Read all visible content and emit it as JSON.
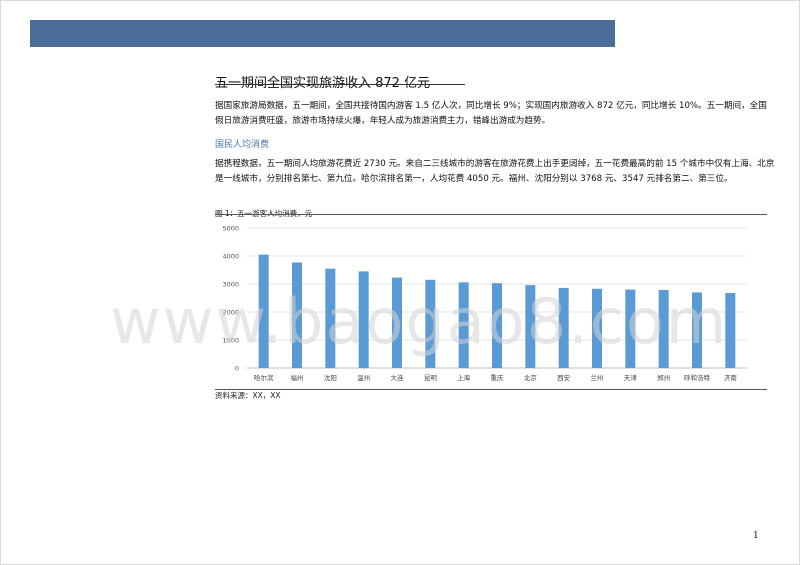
{
  "colors": {
    "header_bar": "#4a6e98",
    "bar": "#5b9bd5",
    "section_heading": "#4a78ad"
  },
  "document": {
    "title": "五一期间全国实现旅游收入 872 亿元",
    "paragraph1": "据国家旅游局数据，五一期间，全国共接待国内游客 1.5 亿人次，同比增长 9%；实现国内旅游收入 872 亿元，同比增长 10%。五一期间，全国假日旅游消费旺盛，旅游市场持续火爆，年轻人成为旅游消费主力，错峰出游成为趋势。",
    "section_heading": "国民人均消费",
    "paragraph2": "据携程数据，五一期间人均旅游花费近 2730 元。来自二三线城市的游客在旅游花费上出手更阔绰，五一花费最高的前 15 个城市中仅有上海、北京是一线城市，分别排名第七、第九位。哈尔滨排名第一，人均花费 4050 元。福州、沈阳分别以 3768 元、3547 元排名第二、第三位。",
    "figure_caption": "图 1：五一游客人均消费，元",
    "source": "资料来源：XX，XX",
    "page_number": "1"
  },
  "watermark": "www.baogao8.com",
  "chart_data": {
    "type": "bar",
    "title": "",
    "xlabel": "",
    "ylabel": "",
    "categories": [
      "哈尔滨",
      "福州",
      "沈阳",
      "温州",
      "大连",
      "昆明",
      "上海",
      "重庆",
      "北京",
      "西安",
      "兰州",
      "天津",
      "郑州",
      "呼和浩特",
      "济南"
    ],
    "values": [
      4050,
      3768,
      3547,
      3450,
      3230,
      3150,
      3060,
      3030,
      2960,
      2860,
      2830,
      2800,
      2790,
      2700,
      2680
    ],
    "ylim": [
      0,
      5000
    ],
    "yticks": [
      0,
      1000,
      2000,
      3000,
      4000,
      5000
    ],
    "grid": true,
    "legend": "none"
  }
}
